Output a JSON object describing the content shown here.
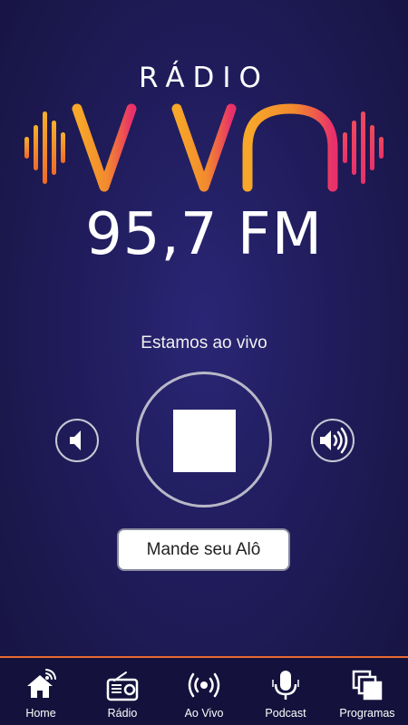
{
  "logo": {
    "radio": "RÁDIO",
    "viva": "VIVA",
    "frequency": "95,7 FM"
  },
  "player": {
    "status_text": "Estamos ao vivo",
    "state_icon": "stop-icon",
    "volume_down_icon": "volume-down-icon",
    "volume_up_icon": "volume-up-icon"
  },
  "alo_button": {
    "label": "Mande seu Alô"
  },
  "nav": {
    "items": [
      {
        "label": "Home",
        "icon": "home-broadcast-icon"
      },
      {
        "label": "Rádio",
        "icon": "radio-icon"
      },
      {
        "label": "Ao Vivo",
        "icon": "live-broadcast-icon"
      },
      {
        "label": "Podcast",
        "icon": "microphone-icon"
      },
      {
        "label": "Programas",
        "icon": "stacked-squares-icon"
      }
    ]
  },
  "colors": {
    "background": "#211d5e",
    "logo_orange": "#f39a2b",
    "logo_pink": "#e8316b",
    "nav_accent": "#e86a33"
  }
}
